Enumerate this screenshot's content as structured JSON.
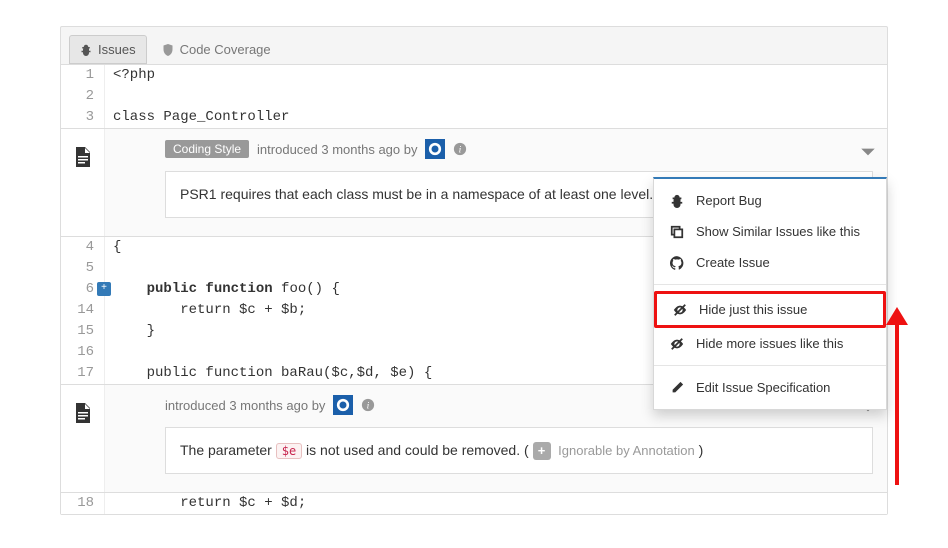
{
  "tabs": {
    "issues": "Issues",
    "coverage": "Code Coverage"
  },
  "code": {
    "l1": {
      "num": "1",
      "text": "<?php"
    },
    "l2": {
      "num": "2",
      "text": ""
    },
    "l3": {
      "num": "3",
      "text": "class Page_Controller"
    },
    "l4": {
      "num": "4",
      "text": "{"
    },
    "l5": {
      "num": "5",
      "text": ""
    },
    "l6": {
      "num": "6",
      "text_pre": "    ",
      "kw": "public function",
      "text_post": " foo() {"
    },
    "l14": {
      "num": "14",
      "text": "        return $c + $b;"
    },
    "l15": {
      "num": "15",
      "text": "    }"
    },
    "l16": {
      "num": "16",
      "text": ""
    },
    "l17": {
      "num": "17",
      "text": "    public function baRau($c,$d, $e) {"
    },
    "l18": {
      "num": "18",
      "text": "        return $c + $d;"
    }
  },
  "issue1": {
    "badge": "Coding Style",
    "intro": "introduced 3 months ago by",
    "message": "PSR1 requires that each class must be in a namespace of at least one level."
  },
  "issue2": {
    "intro": "introduced 3 months ago by",
    "msg_pre": "The parameter ",
    "msg_code": "$e",
    "msg_post": " is not used and could be removed. ( ",
    "ignorable": " Ignorable by Annotation",
    "msg_close": " )"
  },
  "menu": {
    "report_bug": "Report Bug",
    "show_similar": "Show Similar Issues like this",
    "create_issue": "Create Issue",
    "hide_this": "Hide just this issue",
    "hide_more": "Hide more issues like this",
    "edit_spec": "Edit Issue Specification"
  }
}
